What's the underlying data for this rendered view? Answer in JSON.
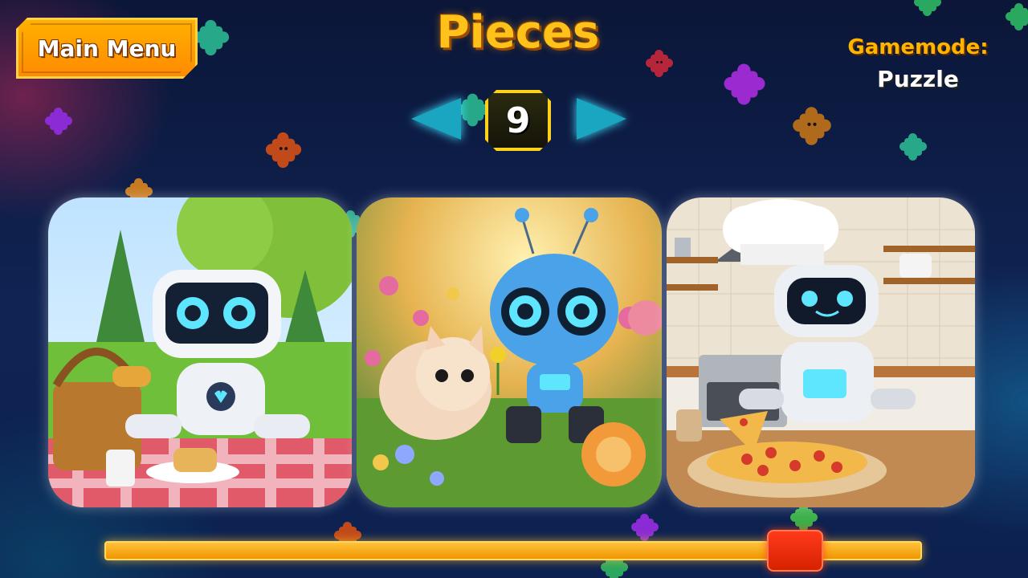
{
  "header": {
    "main_menu_label": "Main Menu",
    "title": "Pieces",
    "gamemode_label": "Gamemode:",
    "gamemode_value": "Puzzle"
  },
  "piece_selector": {
    "value": "9",
    "left_arrow_icon": "left-arrow-icon",
    "right_arrow_icon": "right-arrow-icon"
  },
  "cards": [
    {
      "subject": "robot having a picnic"
    },
    {
      "subject": "blue robot with a kitten in a garden"
    },
    {
      "subject": "chef robot with a pizza"
    }
  ],
  "slider": {
    "position_fraction": 0.87
  },
  "colors": {
    "accent_orange": "#ffb100",
    "title_yellow": "#ffc21a",
    "arrow_cyan": "#1aa6c0",
    "handle_red": "#ff3a1a",
    "background_navy": "#102454"
  }
}
